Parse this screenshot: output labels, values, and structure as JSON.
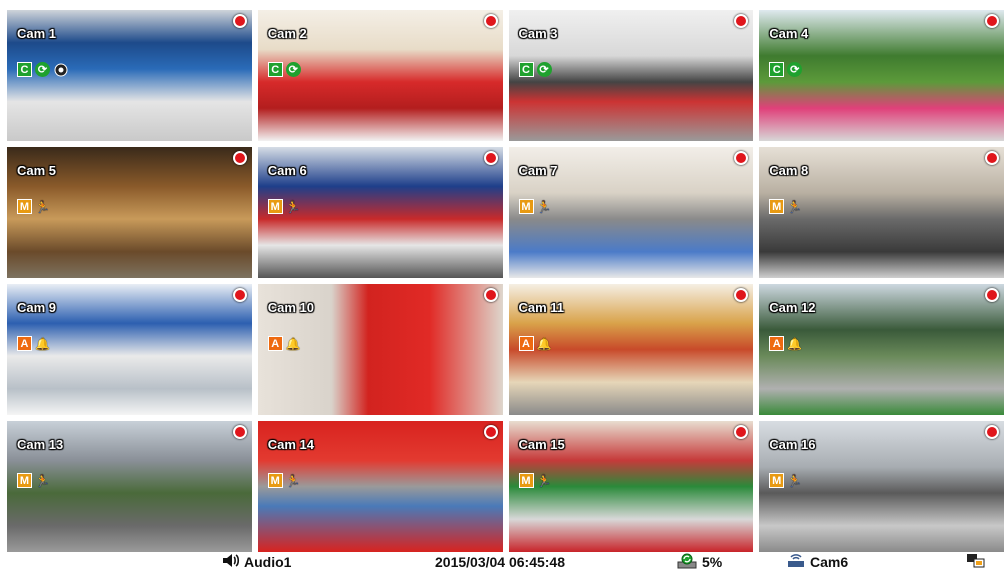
{
  "cameras": [
    {
      "label": "Cam 1",
      "badge": "C",
      "icons": [
        "rotate-icon",
        "camera-icon"
      ],
      "scene": "control-room"
    },
    {
      "label": "Cam 2",
      "badge": "C",
      "icons": [
        "rotate-icon"
      ],
      "scene": "supermarket-checkout"
    },
    {
      "label": "Cam 3",
      "badge": "C",
      "icons": [
        "rotate-icon"
      ],
      "scene": "turnstiles"
    },
    {
      "label": "Cam 4",
      "badge": "C",
      "icons": [
        "rotate-icon"
      ],
      "scene": "garden"
    },
    {
      "label": "Cam 5",
      "badge": "M",
      "icons": [
        "motion-icon"
      ],
      "scene": "shop-front"
    },
    {
      "label": "Cam 6",
      "badge": "M",
      "icons": [
        "motion-icon"
      ],
      "scene": "counter"
    },
    {
      "label": "Cam 7",
      "badge": "M",
      "icons": [
        "motion-icon"
      ],
      "scene": "mall-escalator"
    },
    {
      "label": "Cam 8",
      "badge": "M",
      "icons": [
        "motion-icon"
      ],
      "scene": "mall-escalator-2"
    },
    {
      "label": "Cam 9",
      "badge": "A",
      "icons": [
        "bell-icon"
      ],
      "scene": "cashier"
    },
    {
      "label": "Cam 10",
      "badge": "A",
      "icons": [
        "bell-icon"
      ],
      "scene": "atm-red"
    },
    {
      "label": "Cam 11",
      "badge": "A",
      "icons": [
        "bell-icon"
      ],
      "scene": "grocery-aisle"
    },
    {
      "label": "Cam 12",
      "badge": "A",
      "icons": [
        "bell-icon"
      ],
      "scene": "street"
    },
    {
      "label": "Cam 13",
      "badge": "M",
      "icons": [
        "motion-icon"
      ],
      "scene": "city-road"
    },
    {
      "label": "Cam 14",
      "badge": "M",
      "icons": [
        "motion-icon"
      ],
      "scene": "atm-machine"
    },
    {
      "label": "Cam 15",
      "badge": "M",
      "icons": [
        "motion-icon"
      ],
      "scene": "deli-counter"
    },
    {
      "label": "Cam 16",
      "badge": "M",
      "icons": [
        "motion-icon"
      ],
      "scene": "plaza"
    }
  ],
  "statusbar": {
    "audio_label": "Audio1",
    "datetime": "2015/03/04 06:45:48",
    "hdd_percent": "5%",
    "active_cam": "Cam6"
  },
  "colors": {
    "rec": "#e0161c",
    "badge_c": "#1fa12e",
    "badge_m": "#e89a12",
    "badge_a": "#ee6a10"
  }
}
